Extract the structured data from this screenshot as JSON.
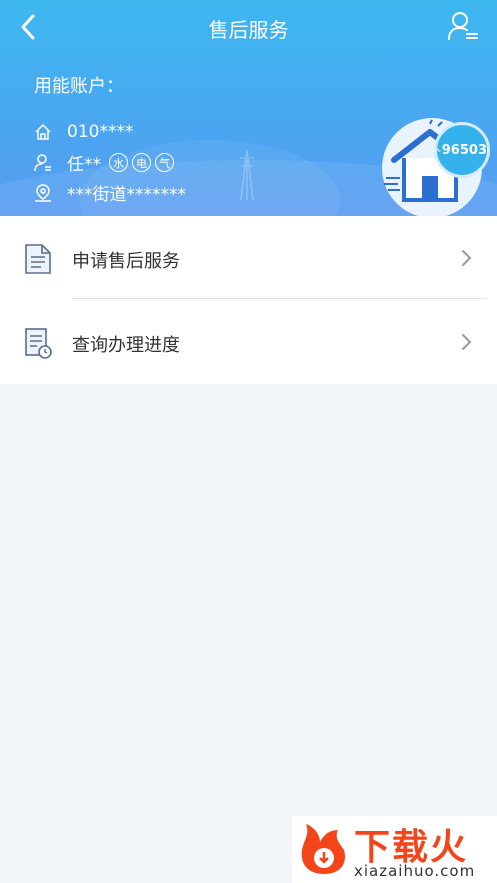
{
  "header": {
    "title": "售后服务",
    "account_label": "用能账户：",
    "account_id": "010****",
    "user_name": "任**",
    "tags": [
      "水",
      "电",
      "气"
    ],
    "address": "***街道*******",
    "hotline": "96503"
  },
  "menu": {
    "items": [
      {
        "label": "申请售后服务"
      },
      {
        "label": "查询办理进度"
      }
    ]
  },
  "watermark": {
    "brand": "下载火",
    "domain": "xiazaihuo.com"
  },
  "colors": {
    "header_top": "#3db8ef",
    "header_bottom": "#5a9cf2",
    "background": "#f2f6fb",
    "accent": "#34b2ee"
  }
}
